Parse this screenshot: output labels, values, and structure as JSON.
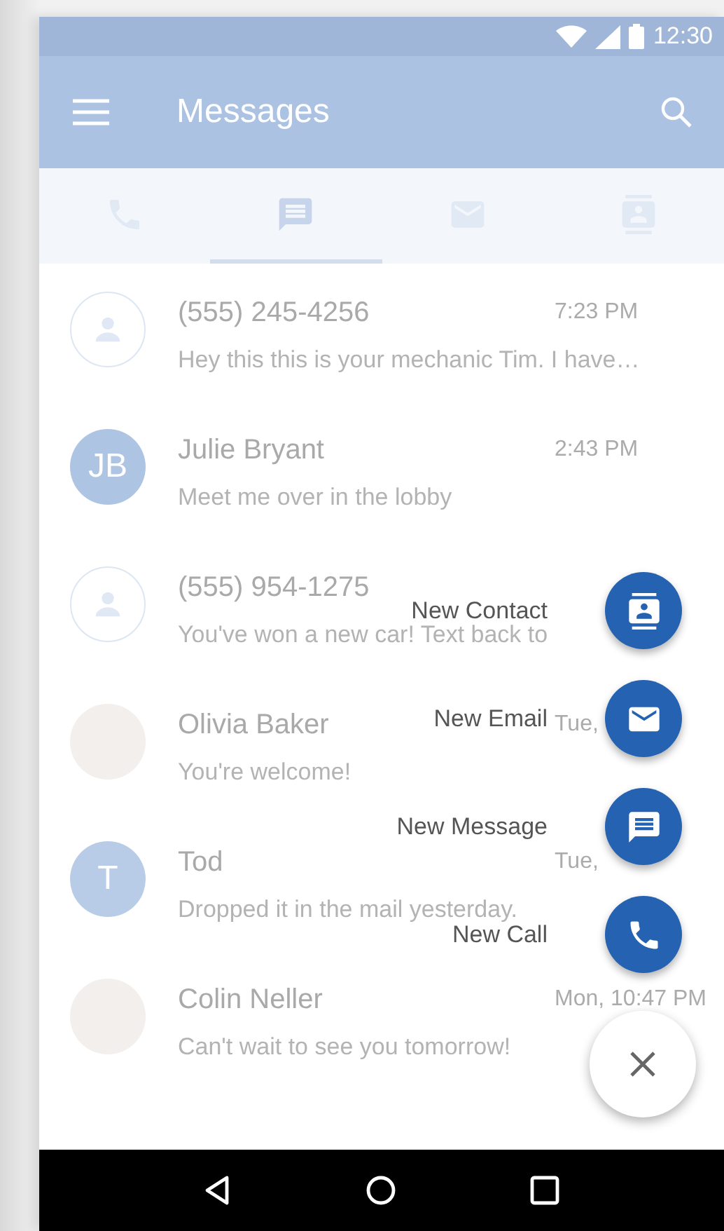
{
  "status_bar": {
    "time": "12:30"
  },
  "app_bar": {
    "title": "Messages"
  },
  "tabs": [
    {
      "kind": "phone",
      "selected": false
    },
    {
      "kind": "message",
      "selected": true
    },
    {
      "kind": "email",
      "selected": false
    },
    {
      "kind": "contact",
      "selected": false
    }
  ],
  "conversations": [
    {
      "kind": "contact",
      "name": "(555) 245-4256",
      "time": "7:23 PM",
      "preview": "Hey this this is your mechanic Tim. I have…"
    },
    {
      "kind": "initials",
      "initials": "JB",
      "color": "#aec4e3",
      "name": "Julie Bryant",
      "time": "2:43 PM",
      "preview": "Meet me over in the lobby"
    },
    {
      "kind": "contact",
      "name": "(555) 954-1275",
      "preview": "You've won a new car! Text back to"
    },
    {
      "kind": "photo",
      "name": "Olivia Baker",
      "time": "Tue,",
      "preview": "You're welcome!"
    },
    {
      "kind": "initials",
      "initials": "T",
      "color": "#b8cce8",
      "name": "Tod",
      "time": "Tue,",
      "preview": "Dropped it in the mail yesterday."
    },
    {
      "kind": "photo",
      "name": "Colin Neller",
      "time": "Mon, 10:47 PM",
      "preview": "Can't wait to see you tomorrow!"
    }
  ],
  "speed_dial": {
    "actions": [
      {
        "kind": "contact",
        "label": "New Contact"
      },
      {
        "kind": "email",
        "label": "New Email"
      },
      {
        "kind": "message",
        "label": "New Message"
      },
      {
        "kind": "call",
        "label": "New Call"
      }
    ]
  }
}
